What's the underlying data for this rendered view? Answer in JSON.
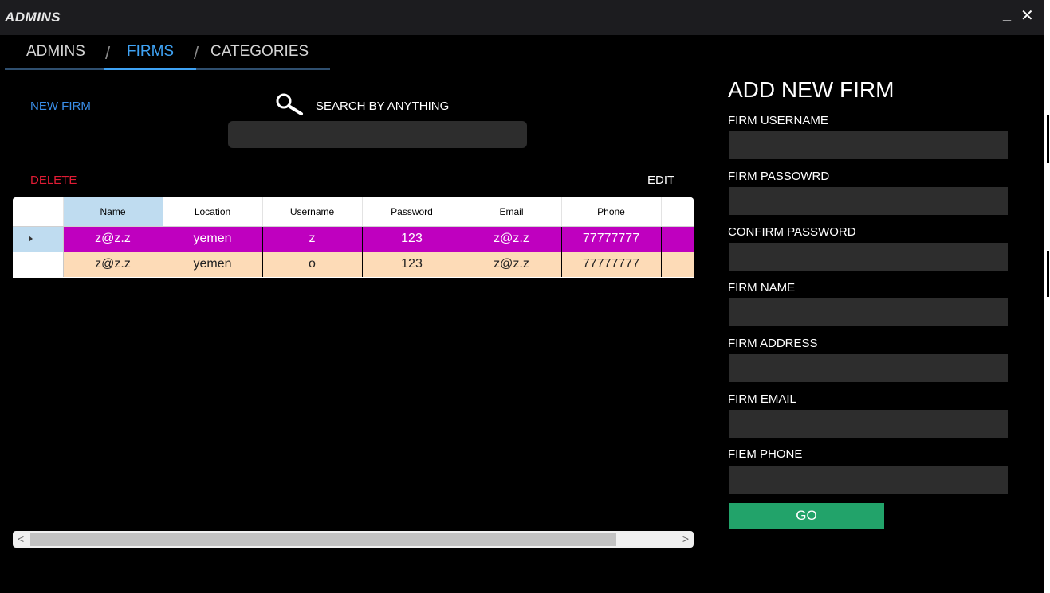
{
  "window": {
    "title": "ADMINS",
    "minimize": "_",
    "close": "✕"
  },
  "tabs": [
    {
      "label": "ADMINS",
      "active": false
    },
    {
      "label": "FIRMS",
      "active": true
    },
    {
      "label": "CATEGORIES",
      "active": false
    }
  ],
  "tab_separator": "/",
  "actions": {
    "new_firm": "NEW FIRM",
    "delete": "DELETE",
    "edit": "EDIT"
  },
  "search": {
    "label": "SEARCH BY ANYTHING",
    "value": "",
    "placeholder": ""
  },
  "grid": {
    "columns": [
      "Name",
      "Location",
      "Username",
      "Password",
      "Email",
      "Phone",
      ""
    ],
    "rows": [
      {
        "cells": [
          "z@z.z",
          "yemen",
          "z",
          "123",
          "z@z.z",
          "77777777",
          ""
        ],
        "selected": true
      },
      {
        "cells": [
          "z@z.z",
          "yemen",
          "o",
          "123",
          "z@z.z",
          "77777777",
          ""
        ],
        "selected": false
      }
    ]
  },
  "scrollbar": {
    "left": "<",
    "right": ">"
  },
  "form": {
    "title": "ADD NEW FIRM",
    "fields": [
      {
        "label": "FIRM USERNAME",
        "value": ""
      },
      {
        "label": "FIRM PASSOWRD",
        "value": ""
      },
      {
        "label": "CONFIRM PASSWORD",
        "value": ""
      },
      {
        "label": "FIRM NAME",
        "value": ""
      },
      {
        "label": "FIRM ADDRESS",
        "value": ""
      },
      {
        "label": "FIRM EMAIL",
        "value": ""
      },
      {
        "label": "FIEM PHONE",
        "value": ""
      }
    ],
    "submit": "GO"
  },
  "colors": {
    "selected_row": "#bf00bf",
    "alt_row": "#fddbb7",
    "active_tab": "#3fa3f5",
    "delete": "#e21c35",
    "go_button": "#22a36a"
  }
}
